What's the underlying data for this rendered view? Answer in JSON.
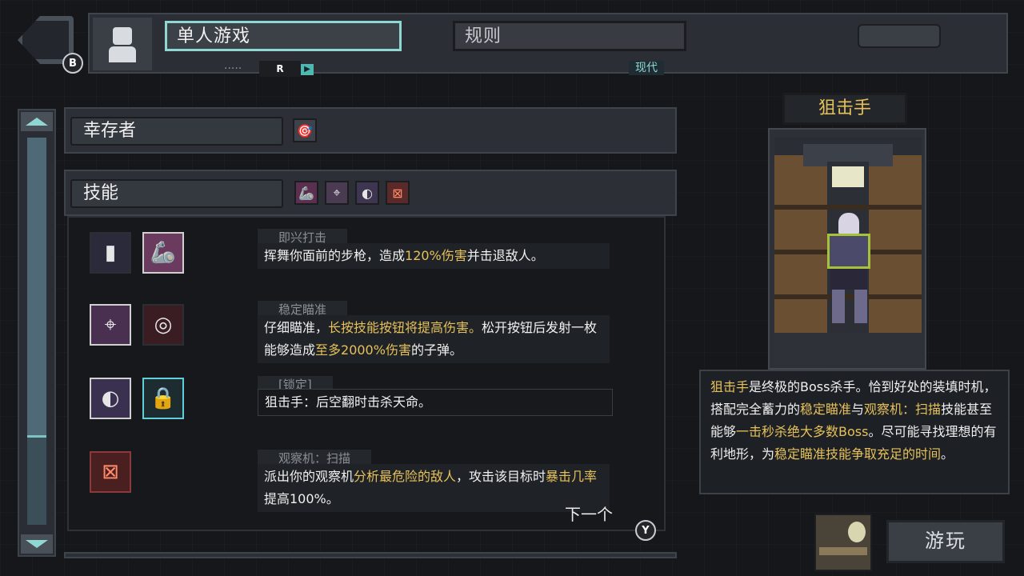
{
  "header": {
    "back_badge": "B",
    "tab_active": "单人游戏",
    "tab_inactive": "规则",
    "mode_label": "现代",
    "r_badge": "R",
    "dots": "....."
  },
  "survivor_section": {
    "label": "幸存者"
  },
  "skills_section": {
    "label": "技能"
  },
  "skills": [
    {
      "title": "即兴打击",
      "desc_parts": [
        {
          "t": "挥舞你面前的步枪，造成",
          "hl": false
        },
        {
          "t": "120%伤害",
          "hl": true
        },
        {
          "t": "并击退敌人。",
          "hl": false
        }
      ]
    },
    {
      "title": "稳定瞄准",
      "desc_parts": [
        {
          "t": "仔细瞄准，",
          "hl": false
        },
        {
          "t": "长按技能按钮将提高伤害。",
          "hl": true
        },
        {
          "t": "松开按钮后发射一枚能够造成",
          "hl": false
        },
        {
          "t": "至多2000%伤害",
          "hl": true
        },
        {
          "t": "的子弹。",
          "hl": false
        }
      ]
    },
    {
      "title": "[锁定]",
      "desc_parts": [
        {
          "t": "狙击手：后空翻时击杀天命。",
          "hl": false
        }
      ]
    },
    {
      "title": "观察机：扫描",
      "desc_parts": [
        {
          "t": "派出你的观察机",
          "hl": false
        },
        {
          "t": "分析最危险的敌人",
          "hl": true
        },
        {
          "t": "，攻击该目标时",
          "hl": false
        },
        {
          "t": "暴击几率",
          "hl": true
        },
        {
          "t": "提高100%。",
          "hl": false
        }
      ]
    }
  ],
  "next": {
    "label": "下一个",
    "badge": "Y"
  },
  "character": {
    "name": "狙击手",
    "desc_parts": [
      {
        "t": "狙击手",
        "hl": true
      },
      {
        "t": "是终极的Boss杀手。恰到好处的装填时机，搭配完全蓄力的",
        "hl": false
      },
      {
        "t": "稳定瞄准",
        "hl": true
      },
      {
        "t": "与",
        "hl": false
      },
      {
        "t": "观察机：扫描",
        "hl": true
      },
      {
        "t": "技能甚至能够",
        "hl": false
      },
      {
        "t": "一击秒杀绝大多数Boss",
        "hl": true
      },
      {
        "t": "。尽可能寻找理想的有利地形，为",
        "hl": false
      },
      {
        "t": "稳定瞄准技能争取充足的时间",
        "hl": true
      },
      {
        "t": "。",
        "hl": false
      }
    ]
  },
  "play_button": "游玩",
  "colors": {
    "accent": "#8fd8d2",
    "highlight": "#e6c15a"
  }
}
